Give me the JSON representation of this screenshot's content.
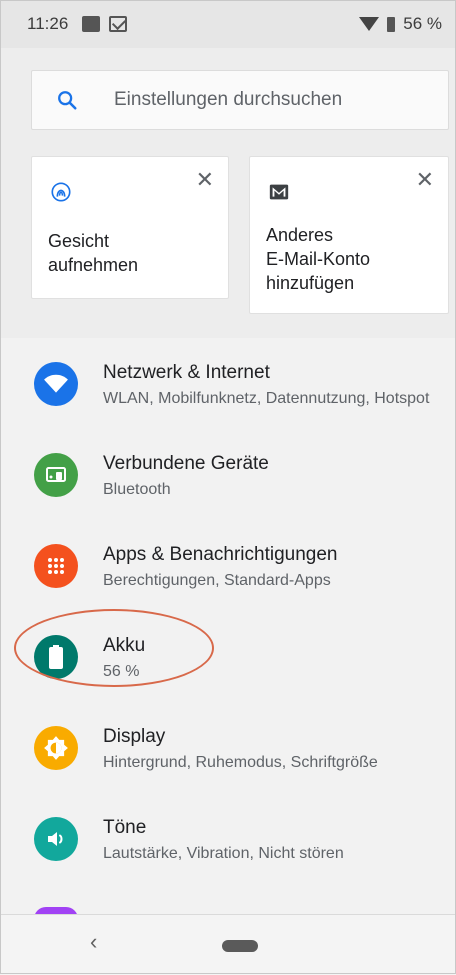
{
  "status_bar": {
    "time": "11:26",
    "battery_percent": "56 %"
  },
  "search": {
    "placeholder": "Einstellungen durchsuchen"
  },
  "suggestions": [
    {
      "text": "Gesicht\naufnehmen",
      "icon": "face-unlock-icon"
    },
    {
      "text": "Anderes\nE-Mail-Konto\nhinzufügen",
      "icon": "gmail-icon"
    }
  ],
  "settings": [
    {
      "title": "Netzwerk & Internet",
      "subtitle": "WLAN, Mobilfunknetz, Datennutzung, Hotspot",
      "color": "#1a73e8",
      "icon": "wifi-icon"
    },
    {
      "title": "Verbundene Geräte",
      "subtitle": "Bluetooth",
      "color": "#43a047",
      "icon": "connected-devices-icon"
    },
    {
      "title": "Apps & Benachrichtigungen",
      "subtitle": "Berechtigungen, Standard-Apps",
      "color": "#f4511e",
      "icon": "apps-icon"
    },
    {
      "title": "Akku",
      "subtitle": "56 %",
      "color": "#00796b",
      "icon": "battery-icon"
    },
    {
      "title": "Display",
      "subtitle": "Hintergrund, Ruhemodus, Schriftgröße",
      "color": "#f9ab00",
      "icon": "display-icon"
    },
    {
      "title": "Töne",
      "subtitle": "Lautstärke, Vibration, Nicht stören",
      "color": "#12a89c",
      "icon": "sound-icon"
    }
  ],
  "colors": {
    "annotation": "#d8694a",
    "partial_item": "#a142f4"
  }
}
